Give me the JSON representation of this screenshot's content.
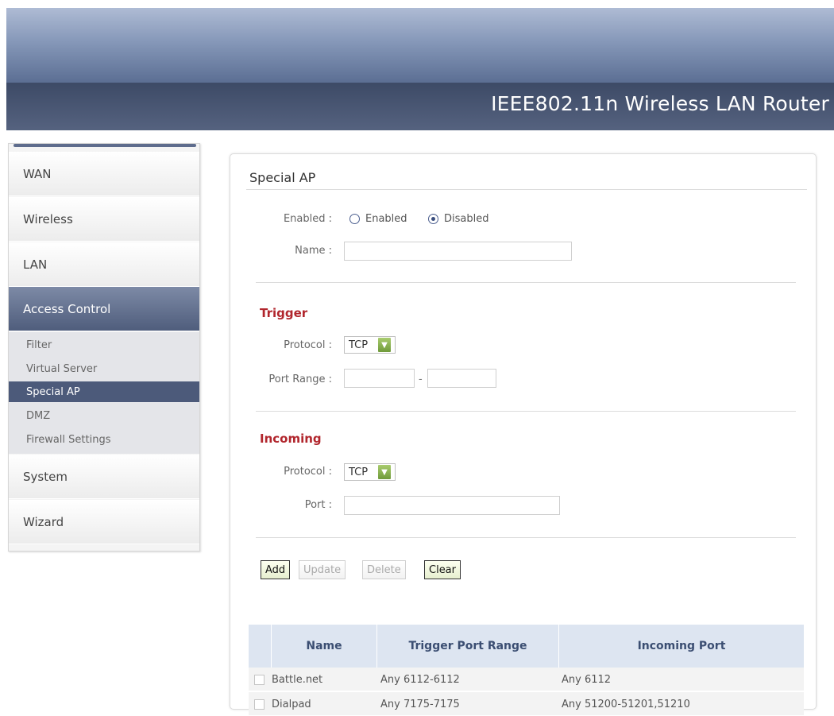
{
  "header": {
    "title": "IEEE802.11n Wireless LAN Router"
  },
  "sidebar": {
    "items": [
      {
        "label": "WAN"
      },
      {
        "label": "Wireless"
      },
      {
        "label": "LAN"
      },
      {
        "label": "Access Control"
      },
      {
        "label": "System"
      },
      {
        "label": "Wizard"
      }
    ],
    "sub_items": [
      {
        "label": "Filter"
      },
      {
        "label": "Virtual Server"
      },
      {
        "label": "Special AP"
      },
      {
        "label": "DMZ"
      },
      {
        "label": "Firewall Settings"
      }
    ],
    "active_item": "Access Control",
    "active_sub_item": "Special AP"
  },
  "main": {
    "title": "Special AP",
    "enabled": {
      "label": "Enabled :",
      "options": [
        {
          "label": "Enabled",
          "selected": false
        },
        {
          "label": "Disabled",
          "selected": true
        }
      ]
    },
    "name": {
      "label": "Name :",
      "value": ""
    },
    "trigger": {
      "title": "Trigger",
      "protocol_label": "Protocol :",
      "protocol_value": "TCP",
      "port_range_label": "Port Range :",
      "port_from": "",
      "separator": "-",
      "port_to": ""
    },
    "incoming": {
      "title": "Incoming",
      "protocol_label": "Protocol :",
      "protocol_value": "TCP",
      "port_label": "Port :",
      "port_value": ""
    },
    "buttons": {
      "add": "Add",
      "update": "Update",
      "delete": "Delete",
      "clear": "Clear"
    },
    "table": {
      "columns": [
        "Name",
        "Trigger Port Range",
        "Incoming Port"
      ],
      "rows": [
        {
          "name": "Battle.net",
          "trigger": "Any 6112-6112",
          "incoming": "Any 6112"
        },
        {
          "name": "Dialpad",
          "trigger": "Any 7175-7175",
          "incoming": "Any 51200-51201,51210"
        }
      ]
    }
  },
  "colors": {
    "header_dark": "#3d4a66",
    "nav_active": "#4f5d7c",
    "section_title": "#b1262d",
    "button_border": "#333333",
    "table_header_bg": "#dde5f1",
    "dropdown_arrow": "#6f9a3a"
  }
}
